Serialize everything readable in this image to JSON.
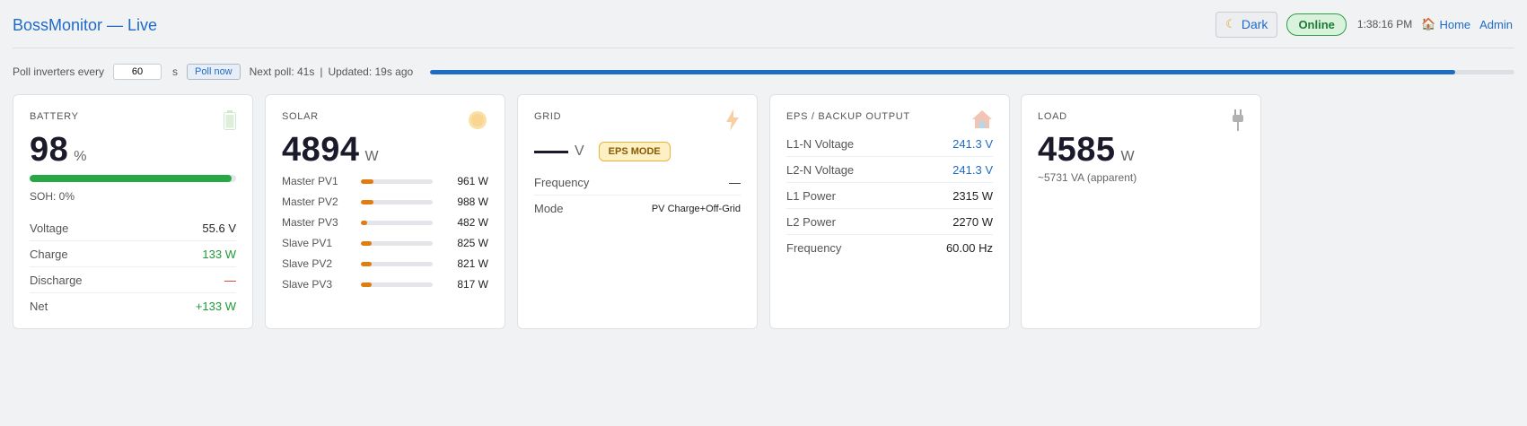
{
  "header": {
    "title": "BossMonitor — Live",
    "dark_label": "Dark",
    "status": "Online",
    "time": "1:38:16 PM",
    "home_label": "Home",
    "admin_label": "Admin"
  },
  "poll": {
    "label": "Poll inverters every",
    "interval_value": "60",
    "unit": "s",
    "poll_now_label": "Poll now",
    "next_poll": "Next poll: 41s",
    "separator": "|",
    "updated": "Updated: 19s ago",
    "progress_fraction": 0.945
  },
  "battery": {
    "title": "BATTERY",
    "value": "98",
    "unit": "%",
    "charge_fraction": 0.98,
    "soh": "SOH: 0%",
    "rows": [
      {
        "label": "Voltage",
        "value": "55.6 V"
      },
      {
        "label": "Charge",
        "value": "133 W"
      },
      {
        "label": "Discharge",
        "value": "—"
      },
      {
        "label": "Net",
        "value": "+133 W"
      }
    ]
  },
  "solar": {
    "title": "SOLAR",
    "value": "4894",
    "unit": "W",
    "pv": [
      {
        "label": "Master PV1",
        "value": "961 W",
        "fraction": 0.18
      },
      {
        "label": "Master PV2",
        "value": "988 W",
        "fraction": 0.18
      },
      {
        "label": "Master PV3",
        "value": "482 W",
        "fraction": 0.09
      },
      {
        "label": "Slave PV1",
        "value": "825 W",
        "fraction": 0.15
      },
      {
        "label": "Slave PV2",
        "value": "821 W",
        "fraction": 0.15
      },
      {
        "label": "Slave PV3",
        "value": "817 W",
        "fraction": 0.15
      }
    ]
  },
  "grid": {
    "title": "GRID",
    "unit": "V",
    "badge": "EPS MODE",
    "rows": [
      {
        "label": "Frequency",
        "value": "—"
      },
      {
        "label": "Mode",
        "value": "PV Charge+Off-Grid"
      }
    ]
  },
  "eps": {
    "title": "EPS / BACKUP OUTPUT",
    "rows": [
      {
        "label": "L1-N Voltage",
        "value": "241.3 V"
      },
      {
        "label": "L2-N Voltage",
        "value": "241.3 V"
      },
      {
        "label": "L1 Power",
        "value": "2315 W"
      },
      {
        "label": "L2 Power",
        "value": "2270 W"
      },
      {
        "label": "Frequency",
        "value": "60.00 Hz"
      }
    ]
  },
  "load": {
    "title": "LOAD",
    "value": "4585",
    "unit": "W",
    "apparent": "~5731 VA (apparent)"
  },
  "colors": {
    "accent": "#1e6bc6",
    "online": "#2e9e47",
    "battery_bar": "#27a844",
    "pv_bar": "#e07c10",
    "eps_badge": "#fdf0c4"
  }
}
